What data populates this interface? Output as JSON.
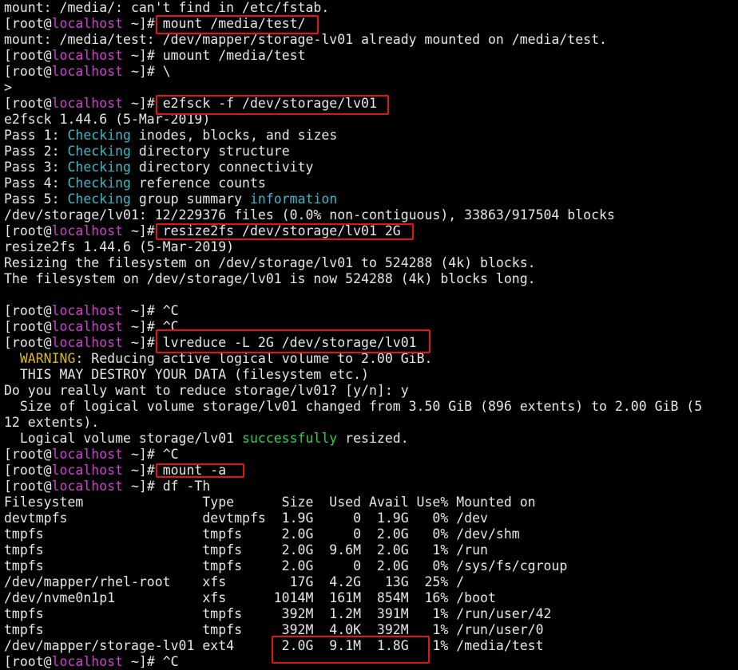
{
  "prompt": {
    "open": "[root@",
    "host": "localhost",
    "close": " ~]# "
  },
  "lines": [
    [
      {
        "t": "mount: /media/: can't find in /etc/fstab."
      }
    ],
    [
      {
        "prompt": true
      },
      {
        "t": "mount /media/test/"
      }
    ],
    [
      {
        "t": "mount: /media/test: /dev/mapper/storage-lv01 already mounted on /media/test."
      }
    ],
    [
      {
        "prompt": true
      },
      {
        "t": "umount /media/test"
      }
    ],
    [
      {
        "prompt": true
      },
      {
        "t": "\\"
      }
    ],
    [
      {
        "t": ">"
      }
    ],
    [
      {
        "prompt": true
      },
      {
        "t": "e2fsck -f /dev/storage/lv01"
      }
    ],
    [
      {
        "t": "e2fsck 1.44.6 (5-Mar-2019)"
      }
    ],
    [
      {
        "t": "Pass 1: "
      },
      {
        "t": "Checking",
        "c": "cyan"
      },
      {
        "t": " inodes, blocks, and sizes"
      }
    ],
    [
      {
        "t": "Pass 2: "
      },
      {
        "t": "Checking",
        "c": "cyan"
      },
      {
        "t": " directory structure"
      }
    ],
    [
      {
        "t": "Pass 3: "
      },
      {
        "t": "Checking",
        "c": "cyan"
      },
      {
        "t": " directory connectivity"
      }
    ],
    [
      {
        "t": "Pass 4: "
      },
      {
        "t": "Checking",
        "c": "cyan"
      },
      {
        "t": " reference counts"
      }
    ],
    [
      {
        "t": "Pass 5: "
      },
      {
        "t": "Checking",
        "c": "cyan"
      },
      {
        "t": " group summary "
      },
      {
        "t": "information",
        "c": "cyan"
      }
    ],
    [
      {
        "t": "/dev/storage/lv01: 12/229376 files (0.0% non-contiguous), 33863/917504 blocks"
      }
    ],
    [
      {
        "prompt": true
      },
      {
        "t": "resize2fs /dev/storage/lv01 2G"
      }
    ],
    [
      {
        "t": "resize2fs 1.44.6 (5-Mar-2019)"
      }
    ],
    [
      {
        "t": "Resizing the filesystem on /dev/storage/lv01 to 524288 (4k) blocks."
      }
    ],
    [
      {
        "t": "The filesystem on /dev/storage/lv01 is now 524288 (4k) blocks long."
      }
    ],
    [],
    [
      {
        "prompt": true
      },
      {
        "t": "^C"
      }
    ],
    [
      {
        "prompt": true
      },
      {
        "t": "^C"
      }
    ],
    [
      {
        "prompt": true
      },
      {
        "t": "lvreduce -L 2G /dev/storage/lv01"
      }
    ],
    [
      {
        "t": "  "
      },
      {
        "t": "WARNING",
        "c": "yellow"
      },
      {
        "t": ": Reducing active logical volume to 2.00 GiB."
      }
    ],
    [
      {
        "t": "  THIS MAY DESTROY YOUR DATA (filesystem etc.)"
      }
    ],
    [
      {
        "t": "Do you really want to reduce storage/lv01? [y/n]: y"
      }
    ],
    [
      {
        "t": "  Size of logical volume storage/lv01 changed from 3.50 GiB (896 extents) to 2.00 GiB (5"
      }
    ],
    [
      {
        "t": "12 extents)."
      }
    ],
    [
      {
        "t": "  Logical volume storage/lv01 "
      },
      {
        "t": "successfully",
        "c": "green"
      },
      {
        "t": " resized."
      }
    ],
    [
      {
        "prompt": true
      },
      {
        "t": "^C"
      }
    ],
    [
      {
        "prompt": true
      },
      {
        "t": "mount -a"
      }
    ],
    [
      {
        "prompt": true
      },
      {
        "t": "df -Th"
      }
    ],
    [
      {
        "t": "Filesystem               Type      Size  Used Avail Use% Mounted on"
      }
    ],
    [
      {
        "t": "devtmpfs                 devtmpfs  1.9G     0  1.9G   0% /dev"
      }
    ],
    [
      {
        "t": "tmpfs                    tmpfs     2.0G     0  2.0G   0% /dev/shm"
      }
    ],
    [
      {
        "t": "tmpfs                    tmpfs     2.0G  9.6M  2.0G   1% /run"
      }
    ],
    [
      {
        "t": "tmpfs                    tmpfs     2.0G     0  2.0G   0% /sys/fs/cgroup"
      }
    ],
    [
      {
        "t": "/dev/mapper/rhel-root    xfs        17G  4.2G   13G  25% /"
      }
    ],
    [
      {
        "t": "/dev/nvme0n1p1           xfs      1014M  161M  854M  16% /boot"
      }
    ],
    [
      {
        "t": "tmpfs                    tmpfs     392M  1.2M  391M   1% /run/user/42"
      }
    ],
    [
      {
        "t": "tmpfs                    tmpfs     392M  4.0K  392M   1% /run/user/0"
      }
    ],
    [
      {
        "t": "/dev/mapper/storage-lv01 ext4      2.0G  9.1M  1.8G   1% /media/test"
      }
    ],
    [
      {
        "prompt": true
      },
      {
        "t": "^C"
      }
    ]
  ],
  "highlight_color": "#e21515"
}
